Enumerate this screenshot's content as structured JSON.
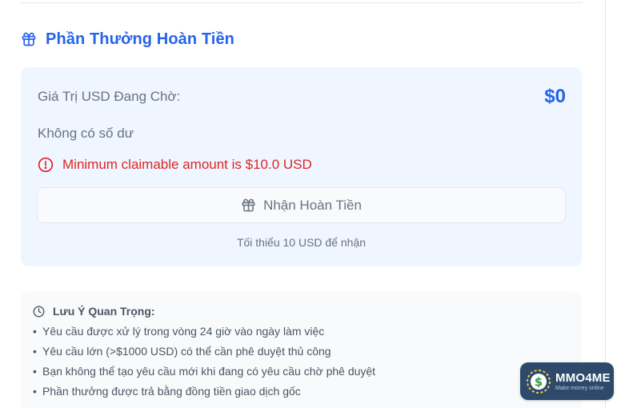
{
  "section": {
    "title": "Phần Thưởng Hoàn Tiền",
    "icon": "gift-icon",
    "accent_color": "#2563eb"
  },
  "reward": {
    "pending_label": "Giá Trị USD Đang Chờ:",
    "pending_value": "$0",
    "balance_text": "Không có số dư",
    "error_icon": "alert-circle-icon",
    "error_text": "Minimum claimable amount is $10.0 USD",
    "error_color": "#dc2626",
    "claim_button_label": "Nhận Hoàn Tiền",
    "claim_button_icon": "gift-icon",
    "min_note": "Tối thiểu 10 USD để nhận"
  },
  "notes": {
    "icon": "clock-icon",
    "title": "Lưu Ý Quan Trọng:",
    "items": [
      "Yêu cầu được xử lý trong vòng 24 giờ vào ngày làm việc",
      "Yêu cầu lớn (>$1000 USD) có thể cần phê duyệt thủ công",
      "Bạn không thể tạo yêu cầu mới khi đang có yêu cầu chờ phê duyệt",
      "Phần thưởng được trả bằng đồng tiền giao dịch gốc"
    ]
  },
  "logo": {
    "name": "MMO4ME",
    "tagline": "Make money online"
  }
}
